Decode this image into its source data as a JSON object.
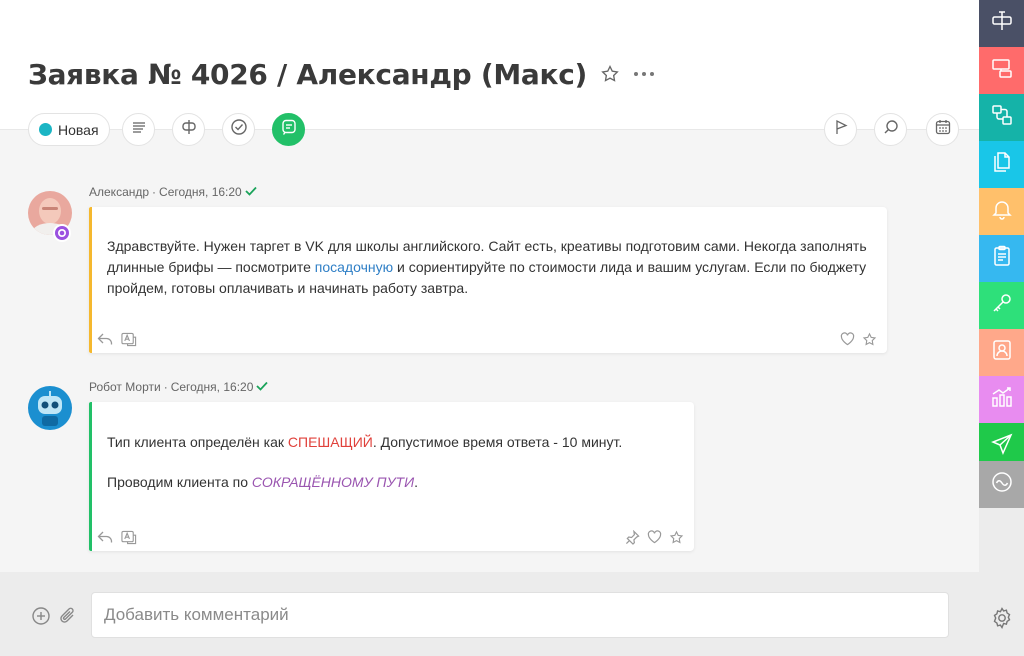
{
  "header": {
    "title": "Заявка № 4026 / Александр (Макс)"
  },
  "toolbar": {
    "status_label": "Новая",
    "status_color": "#1bb5c4",
    "active_color": "#22c068"
  },
  "messages": [
    {
      "author": "Александр",
      "separator": "·",
      "time": "Сегодня, 16:20",
      "bar_color": "#f5b82e",
      "text_before_link": "Здравствуйте. Нужен таргет в VK для школы английского. Сайт есть, креативы подготовим сами. Некогда заполнять длинные брифы — посмотрите ",
      "link_text": "посадочную",
      "text_after_link": " и сориентируйте по стоимости лида и вашим услугам. Если по бюджету пройдем, готовы оплачивать и начинать работу завтра."
    },
    {
      "author": "Робот Морти",
      "separator": "·",
      "time": "Сегодня, 16:20",
      "bar_color": "#22c068",
      "line1_before": "Тип клиента определён как ",
      "line1_highlight": "СПЕШАЩИЙ",
      "line1_after": ". Допустимое время ответа - 10 минут.",
      "line2_before": "Проводим клиента по ",
      "line2_highlight": "СОКРАЩЁННОМУ ПУТИ",
      "line2_after": "."
    }
  ],
  "composer": {
    "placeholder": "Добавить комментарий"
  },
  "sidebar": {
    "items": [
      {
        "icon": "rouble-board-icon",
        "color": "#4a5066"
      },
      {
        "icon": "tasks-flow-icon",
        "color": "#ff6b6b"
      },
      {
        "icon": "process-icon",
        "color": "#15b3a8"
      },
      {
        "icon": "documents-icon",
        "color": "#19c6e8"
      },
      {
        "icon": "bell-icon",
        "color": "#ffc06b"
      },
      {
        "icon": "clipboard-icon",
        "color": "#36b8f0"
      },
      {
        "icon": "key-icon",
        "color": "#2ee07a"
      },
      {
        "icon": "contact-icon",
        "color": "#ffa88a"
      },
      {
        "icon": "analytics-icon",
        "color": "#e88cf0"
      },
      {
        "icon": "send-icon",
        "color": "#1fc94a"
      },
      {
        "icon": "wave-icon",
        "color": "#a8a8a8"
      }
    ]
  }
}
